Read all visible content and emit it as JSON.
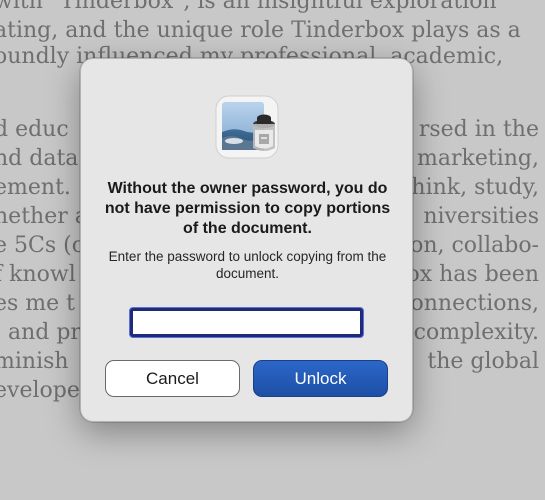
{
  "background_text": [
    "with \"Tinderbox\", is an insightful exploration",
    "ating, and the unique role Tinderbox plays as a",
    "oundly influenced my professional, academic,",
    "d educ",
    "rsed in the",
    "nd data",
    "marketing,",
    "ement.",
    "hink, study,",
    "hether a",
    "niversities",
    "e 5Cs (c",
    "on, collabo-",
    "f knowl",
    "ox has been",
    "es me t",
    "onnections,",
    ", and pr",
    "complexity.",
    "minish",
    "the global",
    "evelope"
  ],
  "dialog": {
    "app_icon": "preview-app-icon",
    "title": "Without the owner password, you do not have permission to copy portions of the document.",
    "message": "Enter the password to unlock copying from the document.",
    "password_field": {
      "value": "",
      "placeholder": ""
    },
    "cancel_label": "Cancel",
    "unlock_label": "Unlock",
    "accent_color": "#2160c0"
  }
}
